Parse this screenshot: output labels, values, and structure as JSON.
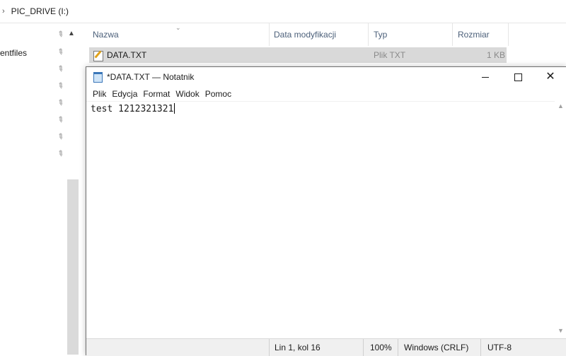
{
  "explorer": {
    "breadcrumb_path": "PIC_DRIVE (I:)",
    "nav_item_label": "entfiles",
    "columns": {
      "name": "Nazwa",
      "modified": "Data modyfikacji",
      "type": "Typ",
      "size": "Rozmiar"
    },
    "file": {
      "name": "DATA.TXT",
      "type": "Plik TXT",
      "size": "1 KB"
    }
  },
  "notepad": {
    "title": "*DATA.TXT — Notatnik",
    "menu": [
      "Plik",
      "Edycja",
      "Format",
      "Widok",
      "Pomoc"
    ],
    "content": "test 1212321321",
    "status": {
      "position": "Lin 1, kol 16",
      "zoom": "100%",
      "line_ending": "Windows (CRLF)",
      "encoding": "UTF-8"
    }
  },
  "icons": {
    "breadcrumb_chevron": "chevron-right-icon",
    "pin": "pin-icon",
    "text_file": "text-file-icon",
    "notepad": "notepad-icon"
  }
}
